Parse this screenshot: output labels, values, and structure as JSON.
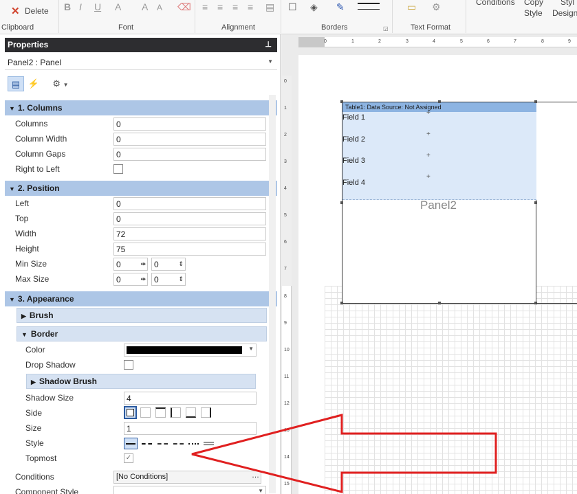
{
  "ribbon": {
    "delete_label": "Delete",
    "groups": [
      "Clipboard",
      "Font",
      "Alignment",
      "Borders",
      "Text Format"
    ],
    "conditions_label": "Conditions",
    "copy_style_label": [
      "Copy",
      "Style"
    ],
    "style_designer_label": [
      "Styl",
      "Design"
    ]
  },
  "properties": {
    "title": "Properties",
    "pin_icon": "📌",
    "object_selector": "Panel2 : Panel",
    "sections": {
      "columns": {
        "title": "1. Columns",
        "columns": {
          "label": "Columns",
          "value": "0"
        },
        "column_width": {
          "label": "Column Width",
          "value": "0"
        },
        "column_gaps": {
          "label": "Column Gaps",
          "value": "0"
        },
        "right_to_left": {
          "label": "Right to Left"
        }
      },
      "position": {
        "title": "2. Position",
        "left": {
          "label": "Left",
          "value": "0"
        },
        "top": {
          "label": "Top",
          "value": "0"
        },
        "width": {
          "label": "Width",
          "value": "72"
        },
        "height": {
          "label": "Height",
          "value": "75"
        },
        "min_size": {
          "label": "Min Size",
          "w": "0",
          "h": "0"
        },
        "max_size": {
          "label": "Max Size",
          "w": "0",
          "h": "0"
        }
      },
      "appearance": {
        "title": "3. Appearance",
        "brush": "Brush",
        "border": {
          "title": "Border",
          "color": {
            "label": "Color",
            "value_color": "#000000"
          },
          "drop_shadow": {
            "label": "Drop Shadow"
          },
          "shadow_brush": "Shadow Brush",
          "shadow_size": {
            "label": "Shadow Size",
            "value": "4"
          },
          "side": {
            "label": "Side"
          },
          "size": {
            "label": "Size",
            "value": "1"
          },
          "style": {
            "label": "Style"
          },
          "topmost": {
            "label": "Topmost",
            "checked": "✓"
          }
        }
      },
      "conditions": {
        "label": "Conditions",
        "value": "[No Conditions]"
      },
      "component_style": {
        "label": "Component Style"
      }
    }
  },
  "designer": {
    "ruler_h": [
      "0",
      "1",
      "2",
      "3",
      "4",
      "5",
      "6",
      "7",
      "8",
      "9"
    ],
    "ruler_v": [
      "0",
      "1",
      "2",
      "3",
      "4",
      "5",
      "6",
      "7",
      "8",
      "9",
      "10",
      "11",
      "12",
      "13",
      "14",
      "15"
    ],
    "table_header": "Table1: Data Source: Not Assigned",
    "fields": [
      "Field 1",
      "Field 2",
      "Field 3",
      "Field 4"
    ],
    "panel_label": "Panel2",
    "panel_next_label": "Pa"
  },
  "colors": {
    "section_bg": "#adc6e6",
    "annotation_arrow": "#e02020"
  }
}
